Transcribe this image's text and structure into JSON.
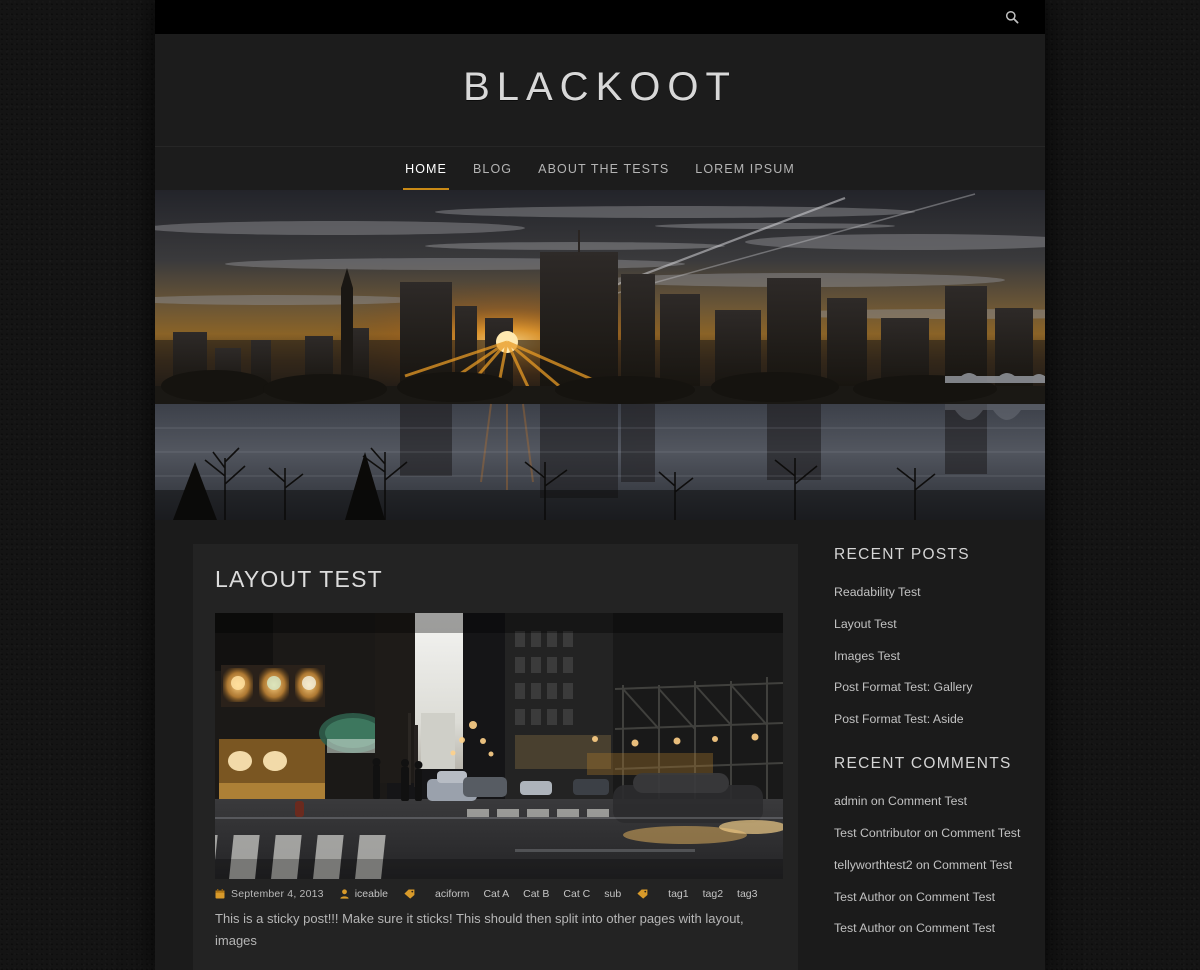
{
  "topbar": {
    "search_icon": "search-icon"
  },
  "brand": {
    "title": "BLACKOOT",
    "tagline": ""
  },
  "nav": {
    "items": [
      {
        "label": "HOME",
        "active": true
      },
      {
        "label": "BLOG",
        "active": false
      },
      {
        "label": "ABOUT THE TESTS",
        "active": false
      },
      {
        "label": "LOREM IPSUM",
        "active": false
      }
    ]
  },
  "hero": {
    "alt": "City skyline at sunset reflected in a river"
  },
  "post": {
    "title": "LAYOUT TEST",
    "thumb_alt": "Busy city street at dusk with lit storefronts and cars",
    "meta": {
      "date_icon": "calendar-icon",
      "date": "September 4, 2013",
      "author_icon": "user-icon",
      "author": "iceable",
      "category_icon": "tag-icon",
      "categories": [
        "aciform",
        "Cat A",
        "Cat B",
        "Cat C",
        "sub"
      ],
      "tag_icon": "tag-icon",
      "tags": [
        "tag1",
        "tag2",
        "tag3"
      ]
    },
    "excerpt": "This is a sticky post!!! Make sure it sticks! This should then split into other pages with layout, images"
  },
  "sidebar": {
    "widgets": [
      {
        "title": "RECENT POSTS",
        "items": [
          "Readability Test",
          "Layout Test",
          "Images Test",
          "Post Format Test: Gallery",
          "Post Format Test: Aside"
        ]
      },
      {
        "title": "RECENT COMMENTS",
        "items": [
          "admin on Comment Test",
          "Test Contributor on Comment Test",
          "tellyworthtest2 on Comment Test",
          "Test Author on Comment Test",
          "Test Author on Comment Test"
        ]
      }
    ]
  },
  "colors": {
    "accent": "#c98a16",
    "page_bg": "#141414",
    "site_bg": "#1b1b1b",
    "card_bg": "#232323",
    "topbar_bg": "#000000"
  }
}
